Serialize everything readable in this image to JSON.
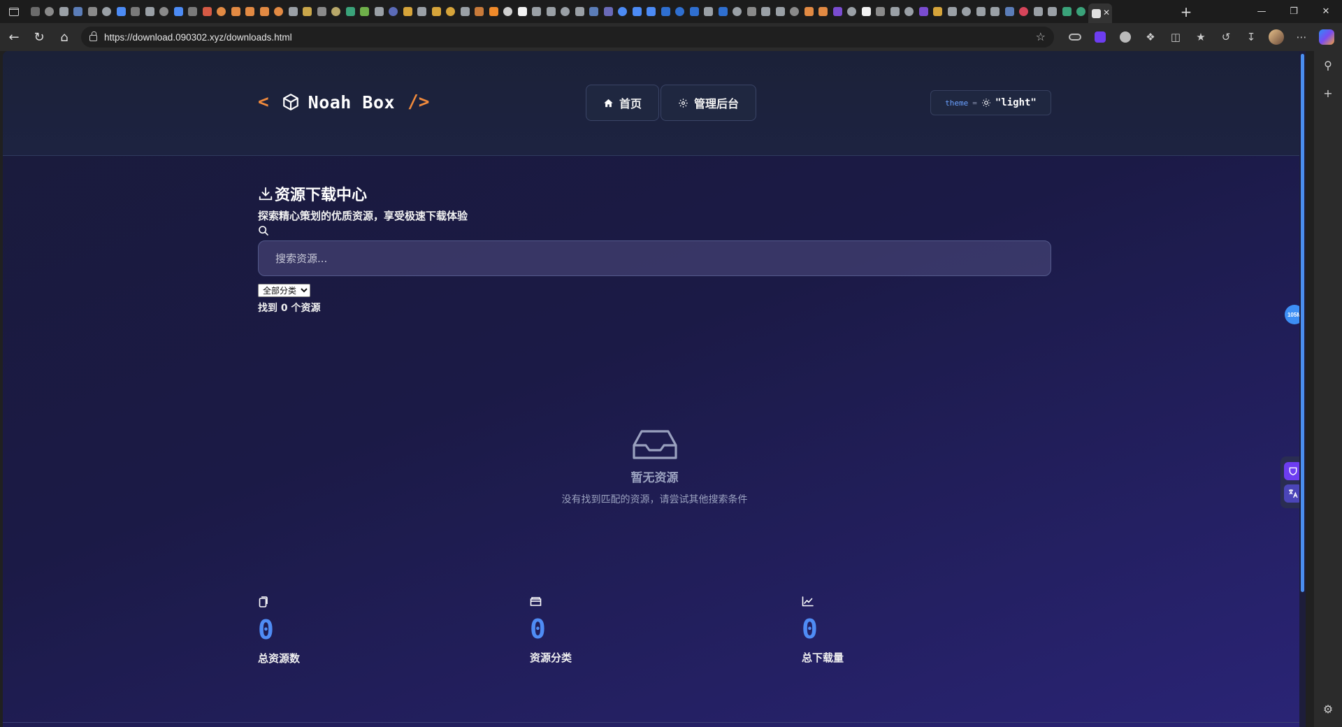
{
  "browser": {
    "url": "https://download.090302.xyz/downloads.html",
    "favicon_colors": [
      "#6b6b6b",
      "#8a8a8a",
      "#9aa0a6",
      "#5b7db8",
      "#8a8a8a",
      "#9aa0a6",
      "#4c8bf5",
      "#7a7a7a",
      "#9aa0a6",
      "#8a8a8a",
      "#4c8bf5",
      "#7a7a7a",
      "#d65a45",
      "#e28a43",
      "#e28a43",
      "#e28a43",
      "#e28a43",
      "#e28a43",
      "#9aa0a6",
      "#c9a64a",
      "#8a8a8a",
      "#b8a86a",
      "#3aa37a",
      "#6fb04a",
      "#9aa0a6",
      "#5b6bb8",
      "#d6a43a",
      "#9aa0a6",
      "#d6a43a",
      "#d6a43a",
      "#9aa0a6",
      "#c87a3a",
      "#f08a2a",
      "#d0d0d0",
      "#f2f2f2",
      "#9aa0a6",
      "#9aa0a6",
      "#9aa0a6",
      "#9aa0a6",
      "#5b7db8",
      "#6a6ab8",
      "#4c8bf5",
      "#4c8bf5",
      "#4c8bf5",
      "#2f6fd0",
      "#2f6fd0",
      "#2f6fd0",
      "#9aa0a6",
      "#2f6fd0",
      "#9aa0a6",
      "#8a8a8a",
      "#9aa0a6",
      "#9aa0a6",
      "#8a8a8a",
      "#e28a43",
      "#e28a43",
      "#7a4cd0",
      "#9aa0a6",
      "#f2f2f2",
      "#8a8a8a",
      "#9aa0a6",
      "#9aa0a6",
      "#7a4cd0",
      "#d6a43a",
      "#9aa0a6",
      "#9aa0a6",
      "#9aa0a6",
      "#9aa0a6",
      "#5b7db8",
      "#d6455a",
      "#9aa0a6",
      "#9aa0a6",
      "#3aa37a",
      "#3aa37a",
      "#e0e0e0"
    ]
  },
  "header": {
    "tag_open": "<",
    "brand_name": "Noah Box",
    "tag_close": "/>",
    "nav": [
      {
        "icon": "home-icon",
        "label": "首页"
      },
      {
        "icon": "gear-icon",
        "label": "管理后台"
      }
    ],
    "theme_key": "theme",
    "theme_eq": "=",
    "theme_value": "\"light\""
  },
  "main": {
    "title": "资源下载中心",
    "subtitle": "探索精心策划的优质资源，享受极速下载体验",
    "search_placeholder": "搜索资源...",
    "category_selected": "全部分类",
    "result_prefix": "找到",
    "result_count": "0",
    "result_suffix": "个资源",
    "empty_title": "暂无资源",
    "empty_desc": "没有找到匹配的资源，请尝试其他搜索条件"
  },
  "stats": [
    {
      "icon": "file-icon",
      "value": "0",
      "label": "总资源数"
    },
    {
      "icon": "folder-icon",
      "value": "0",
      "label": "资源分类"
    },
    {
      "icon": "chart-line-icon",
      "value": "0",
      "label": "总下载量"
    }
  ],
  "widgets": {
    "badge_text": "105M"
  },
  "colors": {
    "accent_orange": "#f08a3c",
    "stat_blue": "#4f8cf5",
    "bg_start": "#1a1b3a",
    "bg_end": "#2a2476"
  }
}
